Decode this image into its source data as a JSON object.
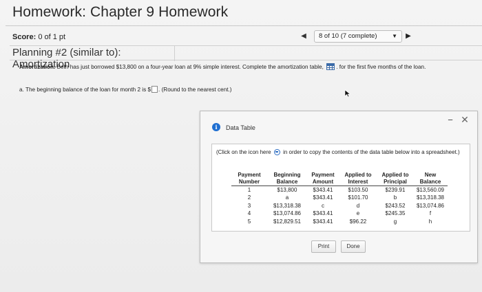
{
  "header": {
    "title": "Homework: Chapter 9 Homework"
  },
  "score": {
    "label": "Score:",
    "value": "0 of 1 pt"
  },
  "nav": {
    "progress": "8 of 10 (7 complete)"
  },
  "question": {
    "title": "Planning #2 (similar to): Amortization"
  },
  "problem": {
    "lead": "Amortization.",
    "text_before_icon": "Beth has just borrowed $13,800 on a four-year loan at 9% simple interest. Complete the amortization table,",
    "text_after_icon": ". for the first five months of the loan."
  },
  "part_a": {
    "text": "a. The beginning balance of the loan for month 2 is $",
    "hint": ". (Round to the nearest cent.)"
  },
  "dialog": {
    "title": "Data Table",
    "note_before": "(Click on the icon here",
    "note_after": "in order to copy the contents of the data table below into a spreadsheet.)",
    "headers": [
      [
        "Payment",
        "Number"
      ],
      [
        "Beginning",
        "Balance"
      ],
      [
        "Payment",
        "Amount"
      ],
      [
        "Applied to",
        "Interest"
      ],
      [
        "Applied to",
        "Principal"
      ],
      [
        "New",
        "Balance"
      ]
    ],
    "rows": [
      [
        "1",
        "$13,800",
        "$343.41",
        "$103.50",
        "$239.91",
        "$13,560.09"
      ],
      [
        "2",
        "a",
        "$343.41",
        "$101.70",
        "b",
        "$13,318.38"
      ],
      [
        "3",
        "$13,318.38",
        "c",
        "d",
        "$243.52",
        "$13,074.86"
      ],
      [
        "4",
        "$13,074.86",
        "$343.41",
        "e",
        "$245.35",
        "f"
      ],
      [
        "5",
        "$12,829.51",
        "$343.41",
        "$96.22",
        "g",
        "h"
      ]
    ],
    "print_label": "Print",
    "done_label": "Done"
  }
}
